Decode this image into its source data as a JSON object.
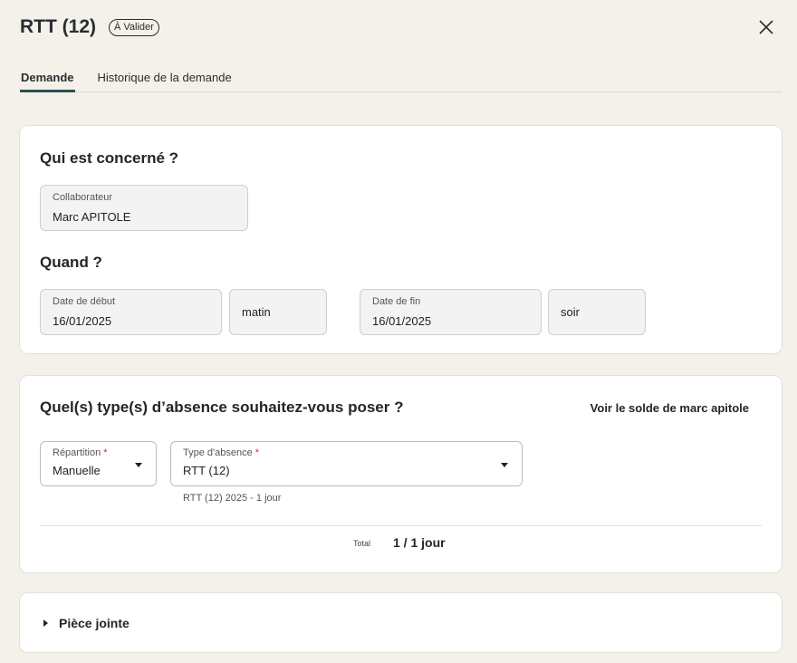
{
  "header": {
    "title": "RTT (12)",
    "status_badge": "À Valider",
    "close_icon": "close-icon"
  },
  "tabs": [
    {
      "label": "Demande",
      "active": true
    },
    {
      "label": "Historique de la demande",
      "active": false
    }
  ],
  "who": {
    "heading": "Qui est concerné ?",
    "collaborator": {
      "label": "Collaborateur",
      "value": "Marc APITOLE"
    }
  },
  "when": {
    "heading": "Quand ?",
    "start_date": {
      "label": "Date de début",
      "value": "16/01/2025"
    },
    "start_period": "matin",
    "end_date": {
      "label": "Date de fin",
      "value": "16/01/2025"
    },
    "end_period": "soir"
  },
  "absence": {
    "heading": "Quel(s) type(s) d’absence souhaitez-vous poser ?",
    "balance_link": "Voir le solde de marc apitole",
    "repartition": {
      "label": "Répartition",
      "required_mark": "*",
      "value": "Manuelle"
    },
    "type": {
      "label": "Type d'absence",
      "required_mark": "*",
      "value": "RTT (12)"
    },
    "type_hint": "RTT (12) 2025 - 1 jour",
    "total_label": "Total",
    "total_value": "1 / 1 jour"
  },
  "attachment": {
    "label": "Pièce jointe"
  },
  "colors": {
    "background": "#f4f1ea",
    "tab_active": "#2f4f54",
    "required": "#c0392b"
  }
}
